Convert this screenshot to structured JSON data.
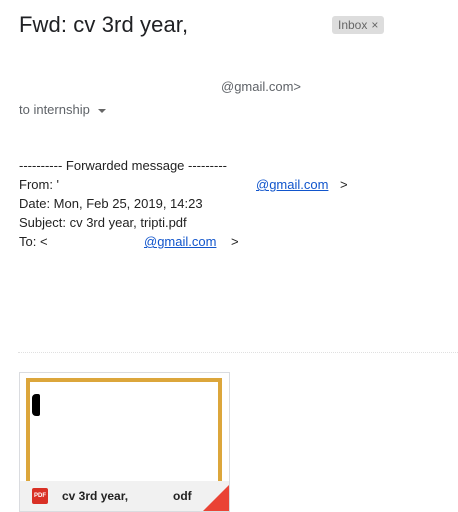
{
  "message": {
    "subject": "Fwd: cv 3rd year,",
    "label": "Inbox",
    "label_remove": "×",
    "sender_email": "@gmail.com>",
    "recipient": "to internship"
  },
  "forwarded": {
    "header": "---------- Forwarded message ---------",
    "from_label": "From: '",
    "from_email": "@gmail.com",
    "from_close": ">",
    "date": "Date: Mon, Feb 25, 2019, 14:23",
    "subject": "Subject: cv 3rd year, tripti.pdf",
    "to_label": "To: <",
    "to_email": "@gmail.com",
    "to_close": ">"
  },
  "attachment": {
    "type_badge": "PDF",
    "name_start": "cv 3rd year,",
    "name_end": "odf"
  },
  "colors": {
    "link": "#1155cc",
    "thumbnail_border": "#dca63b",
    "pdf_red": "#d93025"
  }
}
